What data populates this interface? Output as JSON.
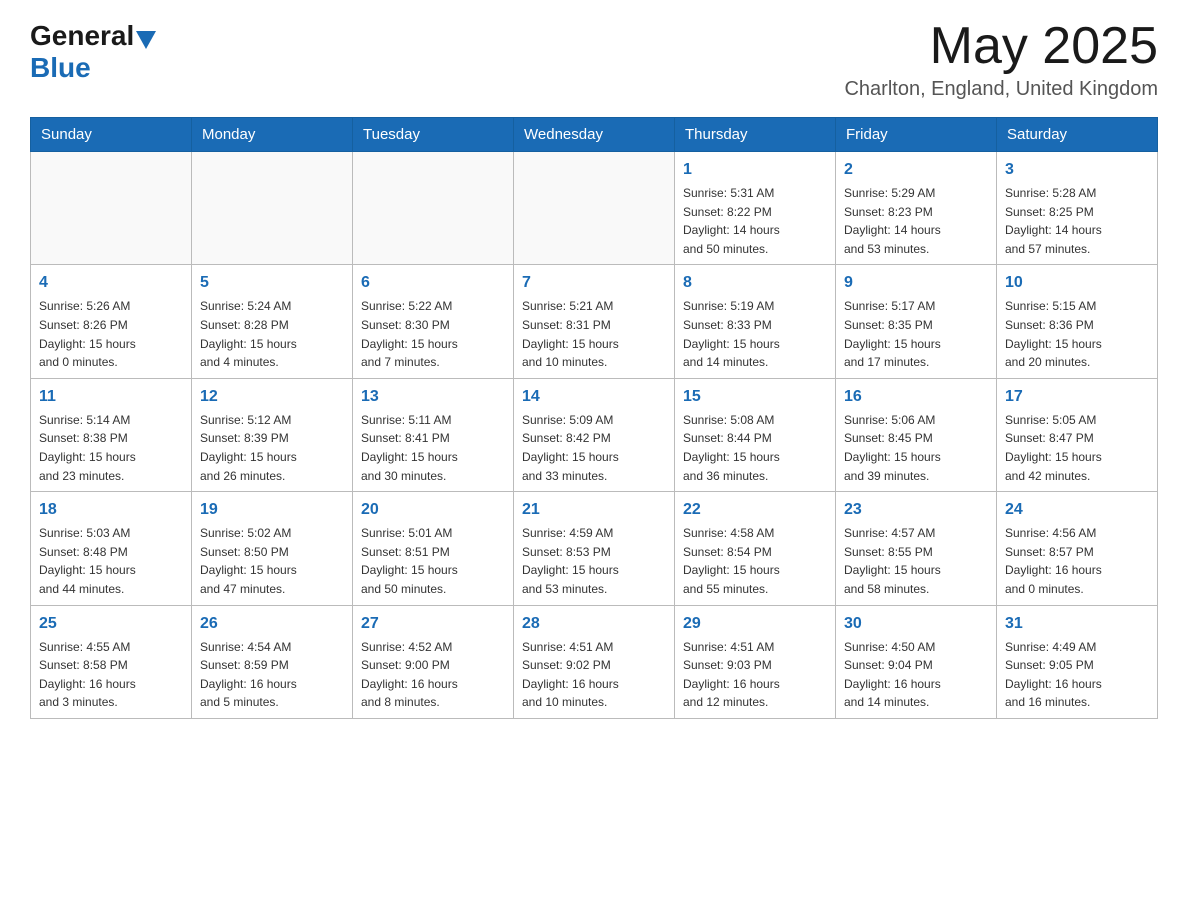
{
  "header": {
    "logo_general": "General",
    "logo_blue": "Blue",
    "month_title": "May 2025",
    "location": "Charlton, England, United Kingdom"
  },
  "weekdays": [
    "Sunday",
    "Monday",
    "Tuesday",
    "Wednesday",
    "Thursday",
    "Friday",
    "Saturday"
  ],
  "weeks": [
    [
      {
        "day": "",
        "info": ""
      },
      {
        "day": "",
        "info": ""
      },
      {
        "day": "",
        "info": ""
      },
      {
        "day": "",
        "info": ""
      },
      {
        "day": "1",
        "info": "Sunrise: 5:31 AM\nSunset: 8:22 PM\nDaylight: 14 hours\nand 50 minutes."
      },
      {
        "day": "2",
        "info": "Sunrise: 5:29 AM\nSunset: 8:23 PM\nDaylight: 14 hours\nand 53 minutes."
      },
      {
        "day": "3",
        "info": "Sunrise: 5:28 AM\nSunset: 8:25 PM\nDaylight: 14 hours\nand 57 minutes."
      }
    ],
    [
      {
        "day": "4",
        "info": "Sunrise: 5:26 AM\nSunset: 8:26 PM\nDaylight: 15 hours\nand 0 minutes."
      },
      {
        "day": "5",
        "info": "Sunrise: 5:24 AM\nSunset: 8:28 PM\nDaylight: 15 hours\nand 4 minutes."
      },
      {
        "day": "6",
        "info": "Sunrise: 5:22 AM\nSunset: 8:30 PM\nDaylight: 15 hours\nand 7 minutes."
      },
      {
        "day": "7",
        "info": "Sunrise: 5:21 AM\nSunset: 8:31 PM\nDaylight: 15 hours\nand 10 minutes."
      },
      {
        "day": "8",
        "info": "Sunrise: 5:19 AM\nSunset: 8:33 PM\nDaylight: 15 hours\nand 14 minutes."
      },
      {
        "day": "9",
        "info": "Sunrise: 5:17 AM\nSunset: 8:35 PM\nDaylight: 15 hours\nand 17 minutes."
      },
      {
        "day": "10",
        "info": "Sunrise: 5:15 AM\nSunset: 8:36 PM\nDaylight: 15 hours\nand 20 minutes."
      }
    ],
    [
      {
        "day": "11",
        "info": "Sunrise: 5:14 AM\nSunset: 8:38 PM\nDaylight: 15 hours\nand 23 minutes."
      },
      {
        "day": "12",
        "info": "Sunrise: 5:12 AM\nSunset: 8:39 PM\nDaylight: 15 hours\nand 26 minutes."
      },
      {
        "day": "13",
        "info": "Sunrise: 5:11 AM\nSunset: 8:41 PM\nDaylight: 15 hours\nand 30 minutes."
      },
      {
        "day": "14",
        "info": "Sunrise: 5:09 AM\nSunset: 8:42 PM\nDaylight: 15 hours\nand 33 minutes."
      },
      {
        "day": "15",
        "info": "Sunrise: 5:08 AM\nSunset: 8:44 PM\nDaylight: 15 hours\nand 36 minutes."
      },
      {
        "day": "16",
        "info": "Sunrise: 5:06 AM\nSunset: 8:45 PM\nDaylight: 15 hours\nand 39 minutes."
      },
      {
        "day": "17",
        "info": "Sunrise: 5:05 AM\nSunset: 8:47 PM\nDaylight: 15 hours\nand 42 minutes."
      }
    ],
    [
      {
        "day": "18",
        "info": "Sunrise: 5:03 AM\nSunset: 8:48 PM\nDaylight: 15 hours\nand 44 minutes."
      },
      {
        "day": "19",
        "info": "Sunrise: 5:02 AM\nSunset: 8:50 PM\nDaylight: 15 hours\nand 47 minutes."
      },
      {
        "day": "20",
        "info": "Sunrise: 5:01 AM\nSunset: 8:51 PM\nDaylight: 15 hours\nand 50 minutes."
      },
      {
        "day": "21",
        "info": "Sunrise: 4:59 AM\nSunset: 8:53 PM\nDaylight: 15 hours\nand 53 minutes."
      },
      {
        "day": "22",
        "info": "Sunrise: 4:58 AM\nSunset: 8:54 PM\nDaylight: 15 hours\nand 55 minutes."
      },
      {
        "day": "23",
        "info": "Sunrise: 4:57 AM\nSunset: 8:55 PM\nDaylight: 15 hours\nand 58 minutes."
      },
      {
        "day": "24",
        "info": "Sunrise: 4:56 AM\nSunset: 8:57 PM\nDaylight: 16 hours\nand 0 minutes."
      }
    ],
    [
      {
        "day": "25",
        "info": "Sunrise: 4:55 AM\nSunset: 8:58 PM\nDaylight: 16 hours\nand 3 minutes."
      },
      {
        "day": "26",
        "info": "Sunrise: 4:54 AM\nSunset: 8:59 PM\nDaylight: 16 hours\nand 5 minutes."
      },
      {
        "day": "27",
        "info": "Sunrise: 4:52 AM\nSunset: 9:00 PM\nDaylight: 16 hours\nand 8 minutes."
      },
      {
        "day": "28",
        "info": "Sunrise: 4:51 AM\nSunset: 9:02 PM\nDaylight: 16 hours\nand 10 minutes."
      },
      {
        "day": "29",
        "info": "Sunrise: 4:51 AM\nSunset: 9:03 PM\nDaylight: 16 hours\nand 12 minutes."
      },
      {
        "day": "30",
        "info": "Sunrise: 4:50 AM\nSunset: 9:04 PM\nDaylight: 16 hours\nand 14 minutes."
      },
      {
        "day": "31",
        "info": "Sunrise: 4:49 AM\nSunset: 9:05 PM\nDaylight: 16 hours\nand 16 minutes."
      }
    ]
  ]
}
